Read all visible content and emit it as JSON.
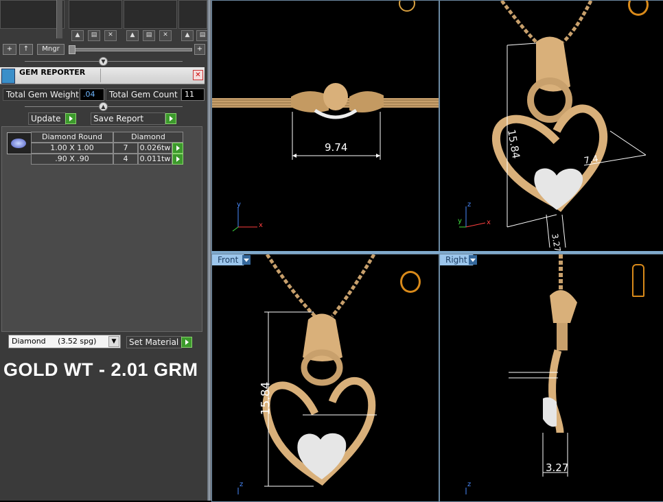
{
  "toolbar": {
    "add_label": "+",
    "up_label": "↑",
    "manager_label": "Mngr",
    "zoom_plus_label": "+"
  },
  "gem_reporter": {
    "title": "GEM REPORTER",
    "total_weight_label": "Total Gem Weight",
    "total_weight_value": ".04",
    "total_count_label": "Total Gem Count",
    "total_count_value": "11",
    "update_label": "Update",
    "save_report_label": "Save Report",
    "table": {
      "headers": [
        "Diamond Round",
        "Diamond"
      ],
      "rows": [
        {
          "size": "1.00 X 1.00",
          "count": "7",
          "weight": "0.026tw"
        },
        {
          "size": ".90 X .90",
          "count": "4",
          "weight": "0.011tw"
        }
      ]
    },
    "material_select": "Diamond     (3.52 spg)",
    "set_material_label": "Set Material"
  },
  "overlay_text": "GOLD WT - 2.01 GRM",
  "viewports": {
    "top": {
      "dimension": "9.74",
      "axis_y": "y",
      "axis_x": "x"
    },
    "perspective": {
      "dimension_height": "15.84",
      "dimension_width": "7.4",
      "dimension_depth": "3.27",
      "axis_z": "z",
      "axis_y": "y",
      "axis_x": "x"
    },
    "front": {
      "label": "Front",
      "dimension": "15.84",
      "axis_z": "z"
    },
    "right": {
      "label": "Right",
      "dimension": "3.27",
      "axis_z": "z"
    }
  },
  "colors": {
    "gold": "#d9b07a",
    "viewport_tag": "#9cc6ec",
    "go_button": "#3c9a2c",
    "gem_weight_value": "#6fb7ff"
  }
}
